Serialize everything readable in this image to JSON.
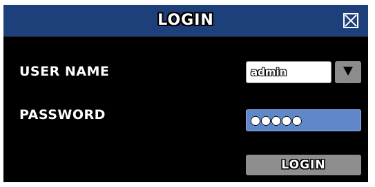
{
  "dialog": {
    "title": "LOGIN",
    "close_icon": "close-box-icon"
  },
  "form": {
    "username_label": "USER NAME",
    "username_value": "admin",
    "username_dropdown_icon": "triangle-down-icon",
    "password_label": "PASSWORD",
    "password_value": "●●●●●",
    "login_button": "LOGIN"
  },
  "colors": {
    "titlebar": "#1d3f7a",
    "background": "#000000",
    "password_field": "#5f87c9",
    "button": "#8e8e8e"
  }
}
